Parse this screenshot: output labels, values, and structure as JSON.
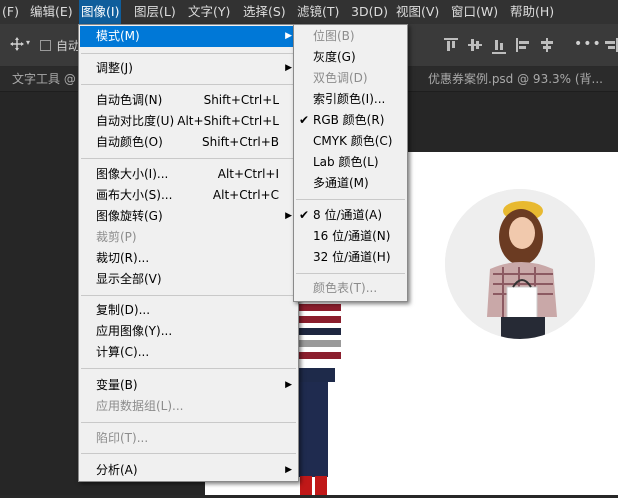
{
  "menubar": [
    {
      "label": "(F)"
    },
    {
      "label": "编辑(E)"
    },
    {
      "label": "图像(I)"
    },
    {
      "label": "图层(L)"
    },
    {
      "label": "文字(Y)"
    },
    {
      "label": "选择(S)"
    },
    {
      "label": "滤镜(T)"
    },
    {
      "label": "3D(D)"
    },
    {
      "label": "视图(V)"
    },
    {
      "label": "窗口(W)"
    },
    {
      "label": "帮助(H)"
    }
  ],
  "options": {
    "auto_label": "自动"
  },
  "tabs": [
    {
      "label": "文字工具 @"
    },
    {
      "label": "优惠券案例.psd @ 93.3% (背..."
    }
  ],
  "image_menu": [
    {
      "label": "模式(M)",
      "submenu": true
    },
    {
      "label": "调整(J)",
      "submenu": true
    },
    {
      "label": "自动色调(N)",
      "shortcut": "Shift+Ctrl+L"
    },
    {
      "label": "自动对比度(U)",
      "shortcut": "Alt+Shift+Ctrl+L"
    },
    {
      "label": "自动颜色(O)",
      "shortcut": "Shift+Ctrl+B"
    },
    {
      "label": "图像大小(I)...",
      "shortcut": "Alt+Ctrl+I"
    },
    {
      "label": "画布大小(S)...",
      "shortcut": "Alt+Ctrl+C"
    },
    {
      "label": "图像旋转(G)",
      "submenu": true
    },
    {
      "label": "裁剪(P)",
      "disabled": true
    },
    {
      "label": "裁切(R)..."
    },
    {
      "label": "显示全部(V)"
    },
    {
      "label": "复制(D)..."
    },
    {
      "label": "应用图像(Y)..."
    },
    {
      "label": "计算(C)..."
    },
    {
      "label": "变量(B)",
      "submenu": true
    },
    {
      "label": "应用数据组(L)...",
      "disabled": true
    },
    {
      "label": "陷印(T)...",
      "disabled": true
    },
    {
      "label": "分析(A)",
      "submenu": true
    }
  ],
  "mode_submenu": [
    {
      "label": "位图(B)",
      "disabled": true
    },
    {
      "label": "灰度(G)"
    },
    {
      "label": "双色调(D)",
      "disabled": true
    },
    {
      "label": "索引颜色(I)..."
    },
    {
      "label": "RGB 颜色(R)",
      "checked": true
    },
    {
      "label": "CMYK 颜色(C)"
    },
    {
      "label": "Lab 颜色(L)"
    },
    {
      "label": "多通道(M)"
    },
    {
      "label": "8 位/通道(A)",
      "checked": true
    },
    {
      "label": "16 位/通道(N)"
    },
    {
      "label": "32 位/通道(H)"
    },
    {
      "label": "颜色表(T)...",
      "disabled": true
    }
  ],
  "colors": {
    "menu_highlight": "#0078d7",
    "menubar_active": "#0f5e9c",
    "menu_bg": "#f0f0f0",
    "app_bg": "#282828"
  }
}
